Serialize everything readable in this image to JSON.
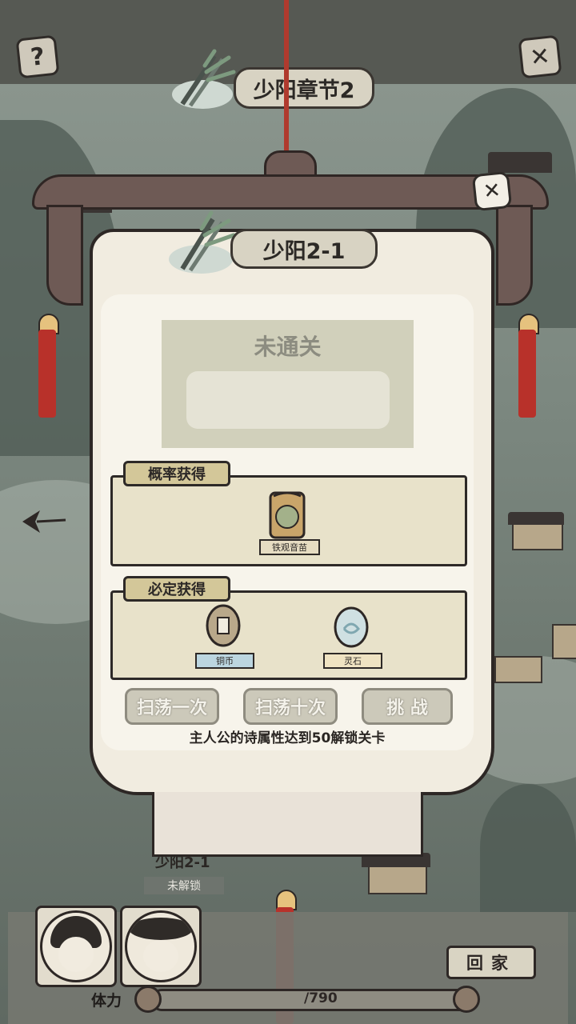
{
  "header": {
    "chapter_title": "少阳章节2",
    "help_icon": "question-icon",
    "close_icon": "x-icon"
  },
  "stage_panel": {
    "title": "少阳2-1",
    "close_icon": "x-icon",
    "status": "未通关",
    "probable_drop": {
      "label": "概率获得",
      "items": [
        {
          "name": "铁观音苗",
          "icon": "seed-bag-icon"
        }
      ]
    },
    "guaranteed_drop": {
      "label": "必定获得",
      "items": [
        {
          "name": "铜币",
          "icon": "coin-icon"
        },
        {
          "name": "灵石",
          "icon": "spirit-stone-icon"
        }
      ]
    },
    "buttons": {
      "sweep_once": "扫荡一次",
      "sweep_ten": "扫荡十次",
      "challenge": "挑 战"
    },
    "unlock_hint": "主人公的诗属性达到50解锁关卡"
  },
  "map_node": {
    "title": "少阳2-1",
    "status": "未解锁"
  },
  "hud": {
    "home_label": "回家",
    "stamina_label": "体力",
    "stamina_value": "/790"
  },
  "colors": {
    "accent_red": "#b8312a",
    "paper": "#f1ece0",
    "ink": "#2d2725"
  }
}
